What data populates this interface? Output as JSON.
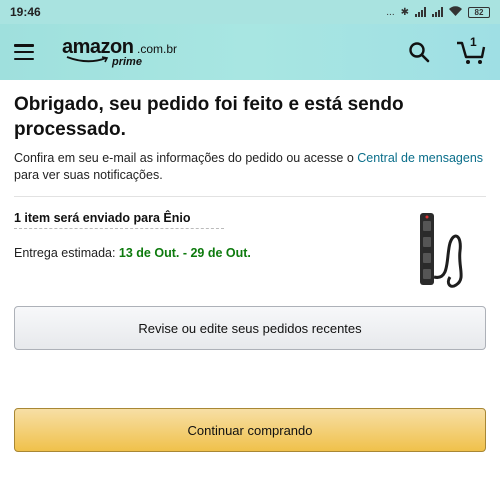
{
  "status_bar": {
    "time": "19:46",
    "signal_text": "...",
    "battery_level": "82"
  },
  "header": {
    "logo_text": "amazon",
    "logo_domain": ".com.br",
    "logo_prime": "prime",
    "cart_count": "1",
    "background_color": "#a8e6e2"
  },
  "confirmation": {
    "title": "Obrigado, seu pedido foi feito e está sendo processado.",
    "subtitle_before_link": "Confira em seu e-mail as informações do pedido ou acesse o ",
    "link_text": "Central de mensagens",
    "subtitle_after_link": "para ver suas notificações."
  },
  "shipment": {
    "ship_to": "1 item será enviado para Ênio",
    "delivery_label": "Entrega estimada: ",
    "delivery_date": "13 de Out. - 29 de Out.",
    "product_icon": "power-strip-icon"
  },
  "buttons": {
    "review_orders": "Revise ou edite seus pedidos recentes",
    "continue_shopping": "Continuar comprando"
  },
  "colors": {
    "link": "#0a6e8a",
    "delivery_date": "#0d7a0d",
    "primary_button": "#f0c14b"
  }
}
